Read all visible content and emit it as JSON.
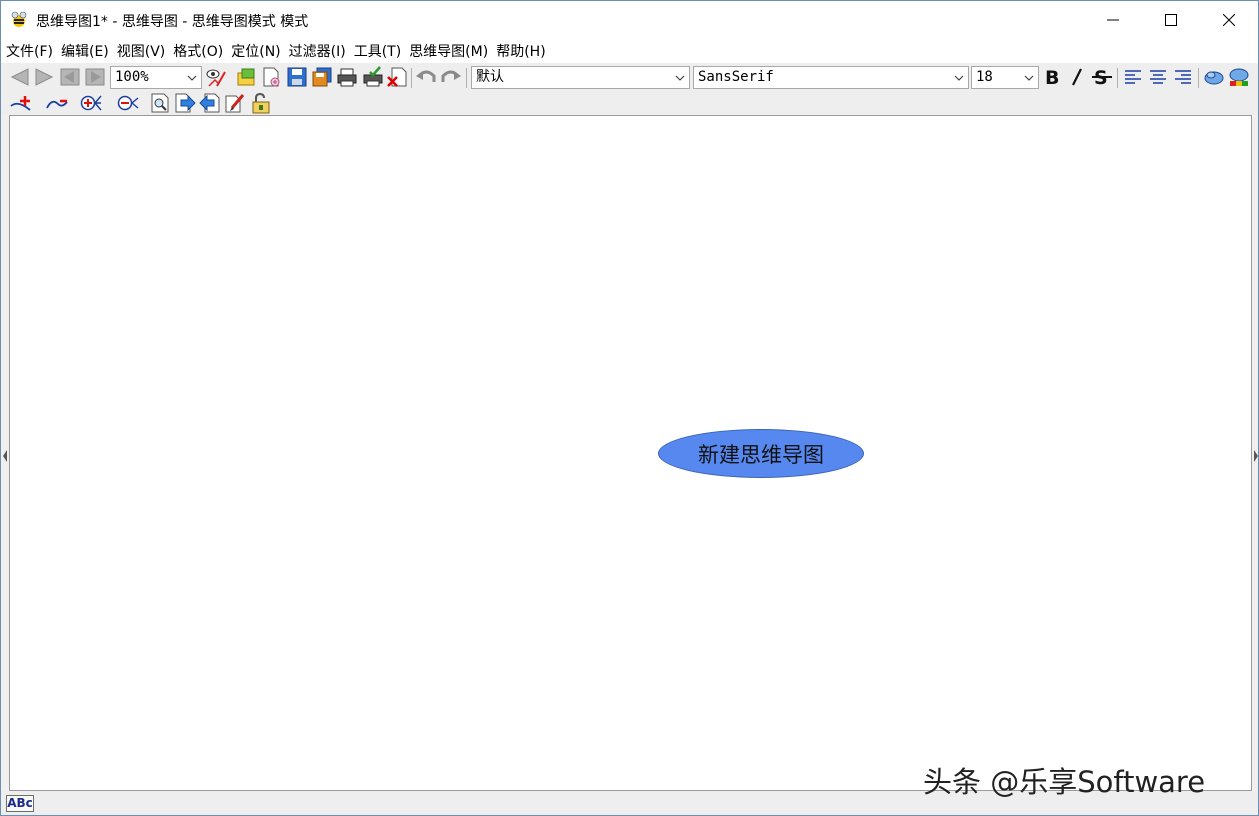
{
  "window": {
    "title": "思维导图1* - 思维导图 - 思维导图模式 模式"
  },
  "menu": {
    "items": [
      "文件(F)",
      "编辑(E)",
      "视图(V)",
      "格式(O)",
      "定位(N)",
      "过滤器(I)",
      "工具(T)",
      "思维导图(M)",
      "帮助(H)"
    ]
  },
  "toolbar": {
    "zoom_value": "100%",
    "style_value": "默认",
    "font_value": "SansSerif",
    "size_value": "18",
    "icons": [
      "back-icon",
      "forward-icon",
      "first-icon",
      "last-icon",
      "zoom-select",
      "preview-icon",
      "open-icon",
      "new-icon",
      "save-icon",
      "save-as-icon",
      "print-icon",
      "print-preview-icon",
      "close-icon",
      "undo-icon",
      "redo-icon",
      "style-select",
      "font-select",
      "size-select",
      "bold-icon",
      "italic-icon",
      "strikethrough-icon",
      "align-left-icon",
      "align-center-icon",
      "align-right-icon",
      "cloud-icon",
      "cloud-color-icon"
    ]
  },
  "toolbar2": {
    "icons": [
      "add-child-icon",
      "remove-link-icon",
      "expand-node-icon",
      "collapse-node-icon",
      "find-icon",
      "next-icon",
      "previous-icon",
      "edit-icon",
      "lock-icon"
    ]
  },
  "canvas": {
    "root_node": "新建思维导图",
    "node_color": "#5688f0"
  },
  "statusbar": {
    "spell_label": "ABc"
  },
  "watermark": "头条 @乐享Software"
}
